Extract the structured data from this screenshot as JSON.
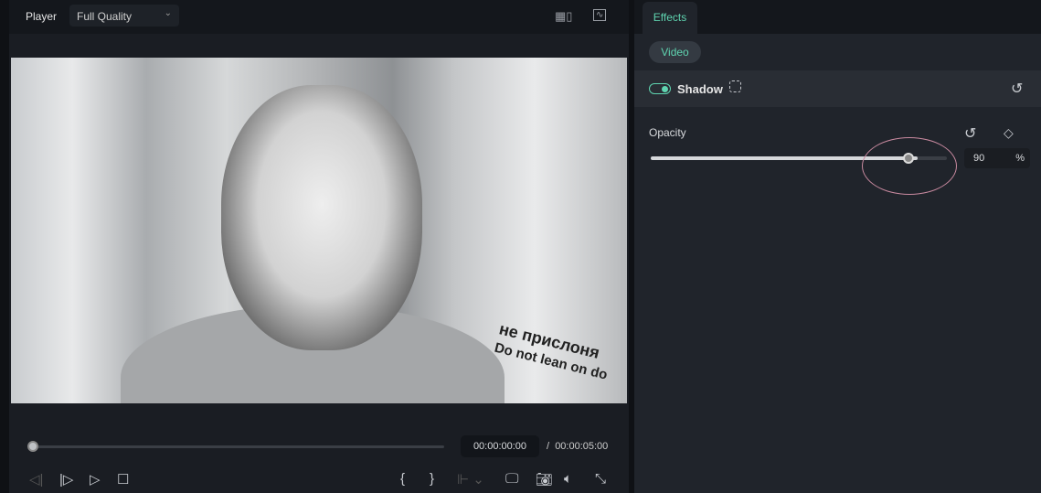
{
  "player": {
    "label": "Player",
    "quality": "Full Quality",
    "current_time": "00:00:00:00",
    "separator": "/",
    "total_time": "00:00:05:00",
    "progress": 0
  },
  "video": {
    "sign_line1": "не прислоня",
    "sign_line2": "Do not lean on do"
  },
  "effects": {
    "tab": "Effects",
    "subtab": "Video",
    "effect_name": "Shadow",
    "effect_enabled": true,
    "opacity_label": "Opacity",
    "opacity_value": "90",
    "opacity_unit": "%",
    "opacity_percent": 90
  },
  "colors": {
    "accent": "#5fd4b0",
    "highlight_oval": "#c98aa0"
  }
}
